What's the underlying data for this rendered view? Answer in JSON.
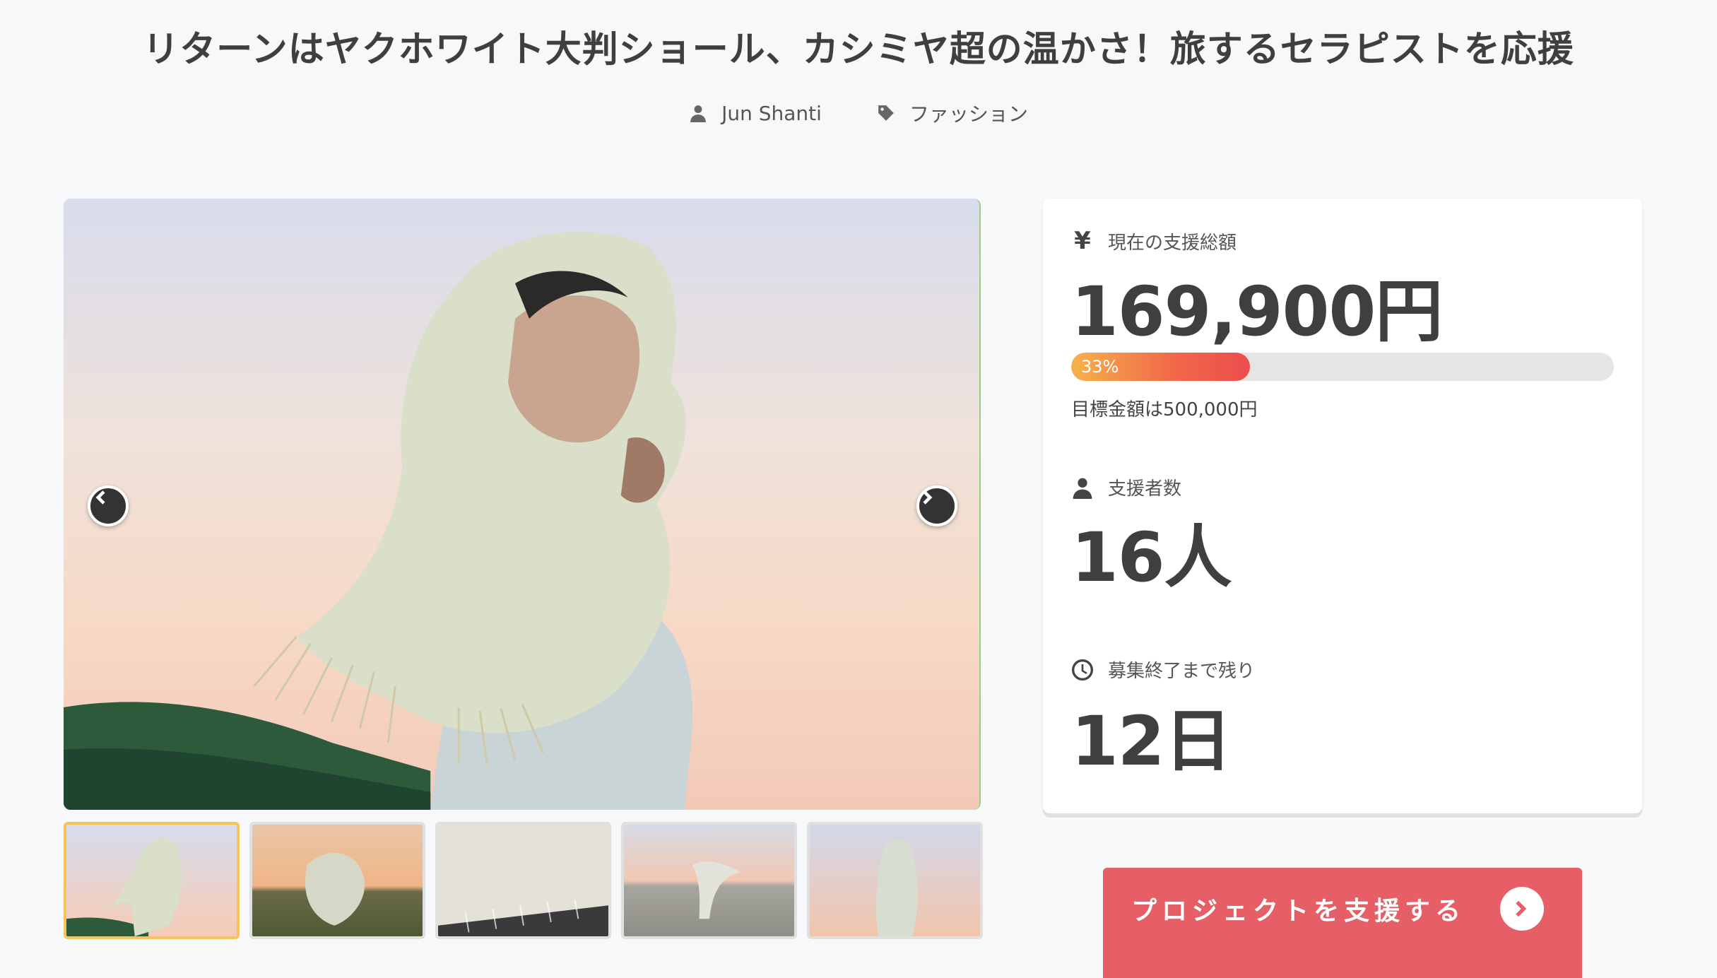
{
  "project": {
    "title": "リターンはヤクホワイト大判ショール、カシミヤ超の温かさ！旅するセラピストを応援",
    "author": "Jun Shanti",
    "category": "ファッション"
  },
  "carousel": {
    "current_slide": 1,
    "total_slides": 5
  },
  "stats": {
    "currency_symbol": "¥",
    "funding_label": "現在の支援総額",
    "funding_amount": "169,900円",
    "progress_percent_label": "33%",
    "progress_fraction": 0.33,
    "goal_text": "目標金額は500,000円",
    "backers_label": "支援者数",
    "backers_count": "16人",
    "remaining_label": "募集終了まで残り",
    "remaining_days": "12日"
  },
  "cta": {
    "label": "プロジェクトを支援する"
  },
  "icons": {
    "author": "user-icon",
    "category": "tag-icon",
    "prev": "chevron-left-icon",
    "next": "chevron-right-icon",
    "backers": "user-icon",
    "remaining": "clock-icon",
    "cta": "chevron-right-circle-icon"
  },
  "colors": {
    "cta_background": "#e65f67",
    "progress_start": "#f6b24a",
    "progress_end": "#ec4d4d",
    "active_thumb_border": "#f4c45a"
  }
}
